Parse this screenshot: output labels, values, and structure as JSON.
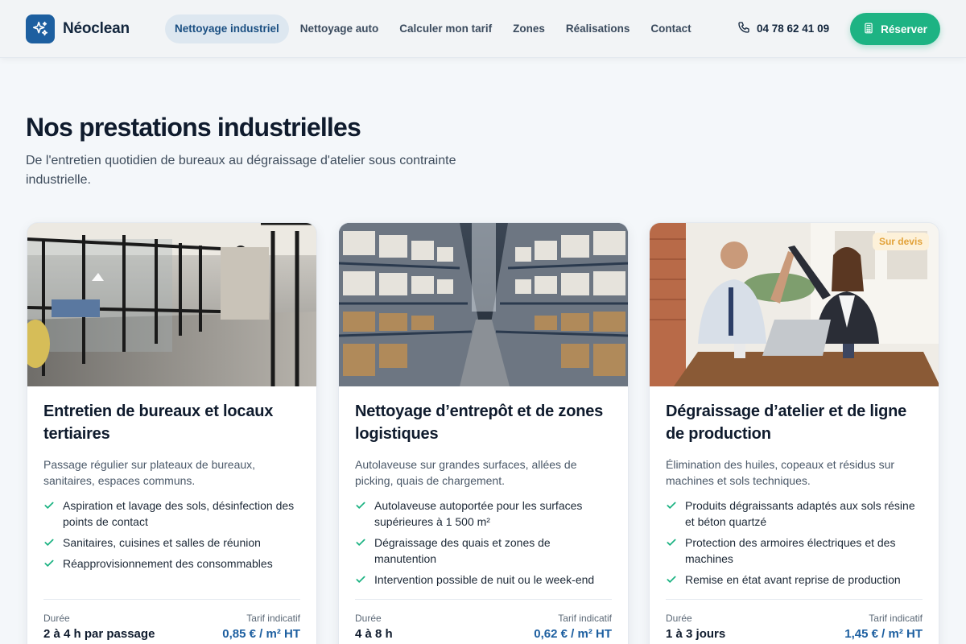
{
  "header": {
    "brand": "Néoclean",
    "nav": [
      {
        "label": "Nettoyage industriel",
        "active": true
      },
      {
        "label": "Nettoyage auto",
        "active": false
      },
      {
        "label": "Calculer mon tarif",
        "active": false
      },
      {
        "label": "Zones",
        "active": false
      },
      {
        "label": "Réalisations",
        "active": false
      },
      {
        "label": "Contact",
        "active": false
      }
    ],
    "phone": "04 78 62 41 09",
    "cta": "Réserver"
  },
  "section": {
    "title": "Nos prestations industrielles",
    "subtitle": "De l'entretien quotidien de bureaux au dégraissage d'atelier sous contrainte industrielle."
  },
  "cards": [
    {
      "title": "Entretien de bureaux et locaux tertiaires",
      "description": "Passage régulier sur plateaux de bureaux, sanitaires, espaces communs.",
      "features": [
        "Aspiration et lavage des sols, désinfection des points de contact",
        "Sanitaires, cuisines et salles de réunion",
        "Réapprovisionnement des consommables"
      ],
      "duration_label": "Durée",
      "duration": "2 à 4 h par passage",
      "price_label": "Tarif indicatif",
      "price": "0,85 € / m² HT",
      "badge": ""
    },
    {
      "title": "Nettoyage d’entrepôt et de zones logistiques",
      "description": "Autolaveuse sur grandes surfaces, allées de picking, quais de chargement.",
      "features": [
        "Autolaveuse autoportée pour les surfaces supérieures à 1 500 m²",
        "Dégraissage des quais et zones de manutention",
        "Intervention possible de nuit ou le week-end"
      ],
      "duration_label": "Durée",
      "duration": "4 à 8 h",
      "price_label": "Tarif indicatif",
      "price": "0,62 € / m² HT",
      "badge": ""
    },
    {
      "title": "Dégraissage d’atelier et de ligne de production",
      "description": "Élimination des huiles, copeaux et résidus sur machines et sols techniques.",
      "features": [
        "Produits dégraissants adaptés aux sols résine et béton quartzé",
        "Protection des armoires électriques et des machines",
        "Remise en état avant reprise de production"
      ],
      "duration_label": "Durée",
      "duration": "1 à 3 jours",
      "price_label": "Tarif indicatif",
      "price": "1,45 € / m² HT",
      "badge": "Sur devis"
    }
  ],
  "colors": {
    "brand": "#1d5fa0",
    "cta": "#1db383",
    "check": "#1db383",
    "badge": "#e2a23a"
  },
  "icons": {
    "logo": "sparkles-icon",
    "phone": "phone-icon",
    "cta": "calculator-icon",
    "feature": "check-icon"
  }
}
